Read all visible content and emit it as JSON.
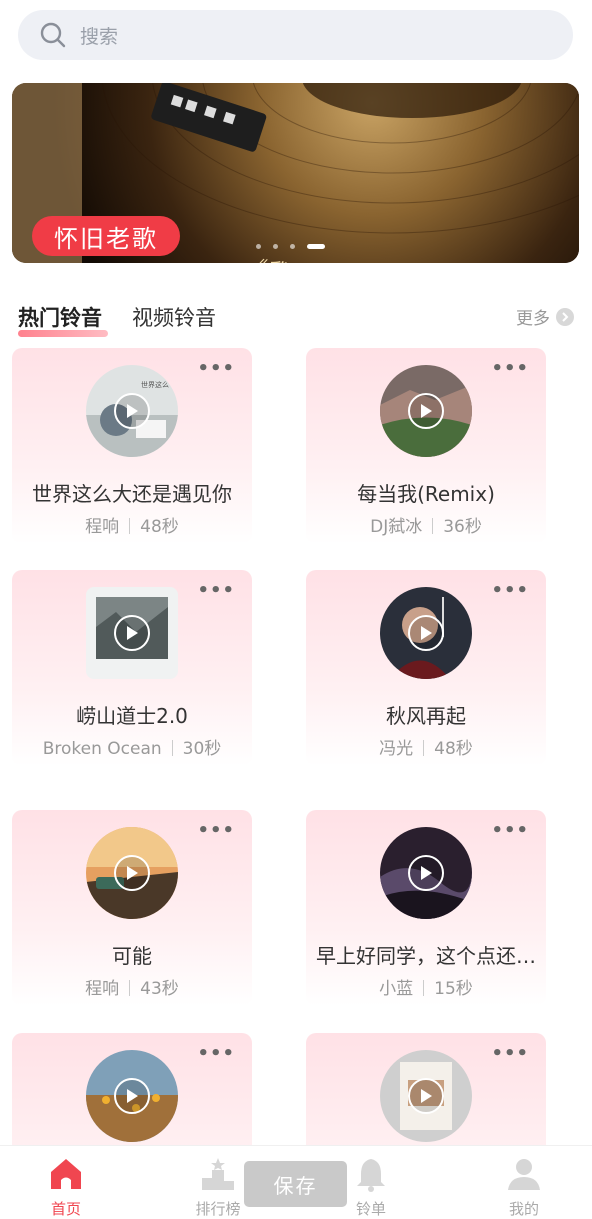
{
  "search": {
    "placeholder": "搜索",
    "icon": "search-icon"
  },
  "banner": {
    "tag": "怀旧老歌",
    "title": "《我的未来不是梦》",
    "dots": 4,
    "active_dot": 4
  },
  "tabs": {
    "items": [
      "热门铃音",
      "视频铃音"
    ],
    "active": "热门铃音",
    "more_label": "更多"
  },
  "cards": [
    {
      "title": "世界这么大还是遇见你",
      "artist": "程响",
      "duration": "48秒"
    },
    {
      "title": "每当我(Remix)",
      "artist": "DJ弑冰",
      "duration": "36秒"
    },
    {
      "title": "崂山道士2.0",
      "artist": "Broken Ocean",
      "duration": "30秒"
    },
    {
      "title": "秋风再起",
      "artist": "冯光",
      "duration": "48秒"
    },
    {
      "title": "可能",
      "artist": "程响",
      "duration": "43秒"
    },
    {
      "title": "早上好同学，这个点还…",
      "artist": "小蓝",
      "duration": "15秒"
    },
    {
      "title": "",
      "artist": "",
      "duration": ""
    },
    {
      "title": "",
      "artist": "",
      "duration": ""
    }
  ],
  "card_menu": "•••",
  "bottom_nav": {
    "items": [
      {
        "label": "首页",
        "icon": "home-icon",
        "active": true
      },
      {
        "label": "排行榜",
        "icon": "podium-icon",
        "active": false
      },
      {
        "label": "铃单",
        "icon": "bell-icon",
        "active": false
      },
      {
        "label": "我的",
        "icon": "user-icon",
        "active": false
      }
    ],
    "save_label": "保存"
  },
  "colors": {
    "accent": "#f03c46",
    "card_bg": "#ffe1e6",
    "search_bg": "#eef0f5"
  }
}
